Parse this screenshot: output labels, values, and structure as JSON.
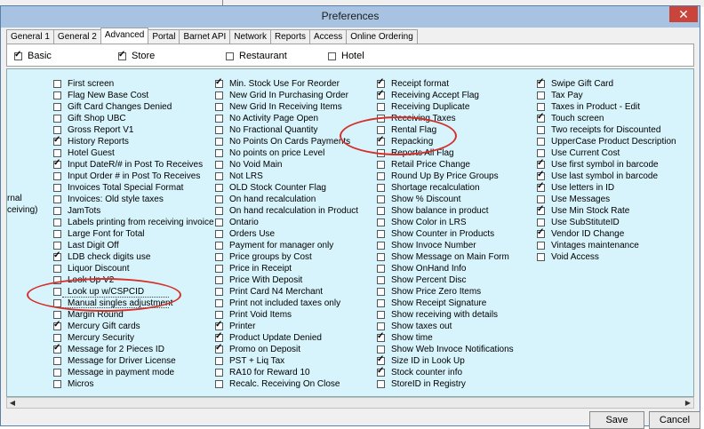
{
  "window": {
    "title": "Preferences",
    "close_glyph": "✕"
  },
  "tabs": [
    {
      "label": "General 1",
      "active": false
    },
    {
      "label": "General 2",
      "active": false
    },
    {
      "label": "Advanced",
      "active": true
    },
    {
      "label": "Portal",
      "active": false
    },
    {
      "label": "Barnet API",
      "active": false
    },
    {
      "label": "Network",
      "active": false
    },
    {
      "label": "Reports",
      "active": false
    },
    {
      "label": "Access",
      "active": false
    },
    {
      "label": "Online Ordering",
      "active": false
    }
  ],
  "categories": [
    {
      "label": "Basic",
      "checked": true
    },
    {
      "label": "Store",
      "checked": true
    },
    {
      "label": "Restaurant",
      "checked": false
    },
    {
      "label": "Hotel",
      "checked": false
    }
  ],
  "cut_labels": [
    "rnal",
    "ceiving)"
  ],
  "columns": [
    [
      {
        "label": "First screen",
        "checked": false
      },
      {
        "label": "Flag New Base Cost",
        "checked": false
      },
      {
        "label": "Gift Card Changes Denied",
        "checked": false
      },
      {
        "label": "Gift Shop UBC",
        "checked": false
      },
      {
        "label": "Gross Report V1",
        "checked": false
      },
      {
        "label": "History Reports",
        "checked": true
      },
      {
        "label": "Hotel Guest",
        "checked": false
      },
      {
        "label": "Input DateR/# in Post To Receives",
        "checked": true
      },
      {
        "label": "Input Order # in Post To Receives",
        "checked": false
      },
      {
        "label": "Invoices Total Special Format",
        "checked": false
      },
      {
        "label": "Invoices: Old style taxes",
        "checked": false
      },
      {
        "label": "JamTots",
        "checked": false
      },
      {
        "label": "Labels printing from receiving invoice",
        "checked": false
      },
      {
        "label": "Large Font for Total",
        "checked": false
      },
      {
        "label": "Last Digit Off",
        "checked": false
      },
      {
        "label": "LDB check digits use",
        "checked": true
      },
      {
        "label": "Liquor Discount",
        "checked": false
      },
      {
        "label": "Look Up V2",
        "checked": false
      },
      {
        "label": "Look up w/CSPCID",
        "checked": false
      },
      {
        "label": "Manual singles adjustment",
        "checked": false
      },
      {
        "label": "Margin Round",
        "checked": false
      },
      {
        "label": "Mercury Gift cards",
        "checked": true
      },
      {
        "label": "Mercury Security",
        "checked": false
      },
      {
        "label": "Message for 2 Pieces ID",
        "checked": true
      },
      {
        "label": "Message for Driver License",
        "checked": false
      },
      {
        "label": "Message in payment mode",
        "checked": false
      },
      {
        "label": "Micros",
        "checked": false
      }
    ],
    [
      {
        "label": "Min. Stock Use For Reorder",
        "checked": true
      },
      {
        "label": "New Grid In Purchasing Order",
        "checked": false
      },
      {
        "label": "New Grid In Receiving Items",
        "checked": false
      },
      {
        "label": "No Activity Page Open",
        "checked": false
      },
      {
        "label": "No Fractional Quantity",
        "checked": false
      },
      {
        "label": "No Points On Cards Payments",
        "checked": false
      },
      {
        "label": "No points on price Level",
        "checked": false
      },
      {
        "label": "No Void Main",
        "checked": false
      },
      {
        "label": "Not LRS",
        "checked": false
      },
      {
        "label": "OLD Stock Counter Flag",
        "checked": false
      },
      {
        "label": "On hand recalculation",
        "checked": false
      },
      {
        "label": "On hand recalculation in Product",
        "checked": false
      },
      {
        "label": "Ontario",
        "checked": false
      },
      {
        "label": "Orders Use",
        "checked": false
      },
      {
        "label": "Payment for manager only",
        "checked": false
      },
      {
        "label": "Price groups by Cost",
        "checked": false
      },
      {
        "label": "Price in Receipt",
        "checked": false
      },
      {
        "label": "Price With Deposit",
        "checked": false
      },
      {
        "label": "Print Card N4 Merchant",
        "checked": false
      },
      {
        "label": "Print not included taxes only",
        "checked": false
      },
      {
        "label": "Print Void Items",
        "checked": false
      },
      {
        "label": "Printer",
        "checked": true
      },
      {
        "label": "Product Update Denied",
        "checked": true
      },
      {
        "label": "Promo on Deposit",
        "checked": true
      },
      {
        "label": "PST + Liq Tax",
        "checked": false
      },
      {
        "label": "RA10 for Reward 10",
        "checked": false
      },
      {
        "label": "Recalc. Receiving On Close",
        "checked": false
      }
    ],
    [
      {
        "label": "Receipt format",
        "checked": true
      },
      {
        "label": "Receiving Accept Flag",
        "checked": true
      },
      {
        "label": "Receiving Duplicate",
        "checked": false
      },
      {
        "label": "Receiving Taxes",
        "checked": false
      },
      {
        "label": "Rental Flag",
        "checked": false
      },
      {
        "label": "Repacking",
        "checked": true
      },
      {
        "label": "Reports All Flag",
        "checked": false
      },
      {
        "label": "Retail Price Change",
        "checked": false
      },
      {
        "label": "Round Up By Price Groups",
        "checked": false
      },
      {
        "label": "Shortage recalculation",
        "checked": false
      },
      {
        "label": "Show % Discount",
        "checked": false
      },
      {
        "label": "Show balance in product",
        "checked": false
      },
      {
        "label": "Show Color in LRS",
        "checked": false
      },
      {
        "label": "Show Counter in Products",
        "checked": false
      },
      {
        "label": "Show Invoce Number",
        "checked": false
      },
      {
        "label": "Show Message on Main Form",
        "checked": false
      },
      {
        "label": "Show OnHand Info",
        "checked": false
      },
      {
        "label": "Show Percent Disc",
        "checked": false
      },
      {
        "label": "Show Price Zero Items",
        "checked": false
      },
      {
        "label": "Show Receipt Signature",
        "checked": false
      },
      {
        "label": "Show receiving with details",
        "checked": false
      },
      {
        "label": "Show taxes out",
        "checked": false
      },
      {
        "label": "Show time",
        "checked": true
      },
      {
        "label": "Show Web Invoce Notifications",
        "checked": false
      },
      {
        "label": "Size ID in Look Up",
        "checked": true
      },
      {
        "label": "Stock counter info",
        "checked": true
      },
      {
        "label": "StoreID in Registry",
        "checked": false
      }
    ],
    [
      {
        "label": "Swipe Gift Card",
        "checked": true
      },
      {
        "label": "Tax Pay",
        "checked": false
      },
      {
        "label": "Taxes in Product - Edit",
        "checked": false
      },
      {
        "label": "Touch screen",
        "checked": true
      },
      {
        "label": "Two receipts for Discounted",
        "checked": false
      },
      {
        "label": "UpperCase Product Description",
        "checked": false
      },
      {
        "label": "Use Current Cost",
        "checked": false
      },
      {
        "label": "Use first symbol in barcode",
        "checked": true
      },
      {
        "label": "Use last symbol in barcode",
        "checked": true
      },
      {
        "label": "Use letters in ID",
        "checked": true
      },
      {
        "label": "Use Messages",
        "checked": false
      },
      {
        "label": "Use Min Stock Rate",
        "checked": true
      },
      {
        "label": "Use SubStituteID",
        "checked": false
      },
      {
        "label": "Vendor ID Change",
        "checked": true
      },
      {
        "label": "Vintages maintenance",
        "checked": false
      },
      {
        "label": "Void Access",
        "checked": false
      }
    ]
  ],
  "scrollbar": {
    "left_arrow": "◀",
    "right_arrow": "▶"
  },
  "buttons": {
    "save": "Save",
    "cancel": "Cancel"
  },
  "colors": {
    "list_bg": "#d7f3fb",
    "titlebar": "#a8c3e2",
    "annotation": "#d3312a",
    "close": "#c9443a"
  }
}
